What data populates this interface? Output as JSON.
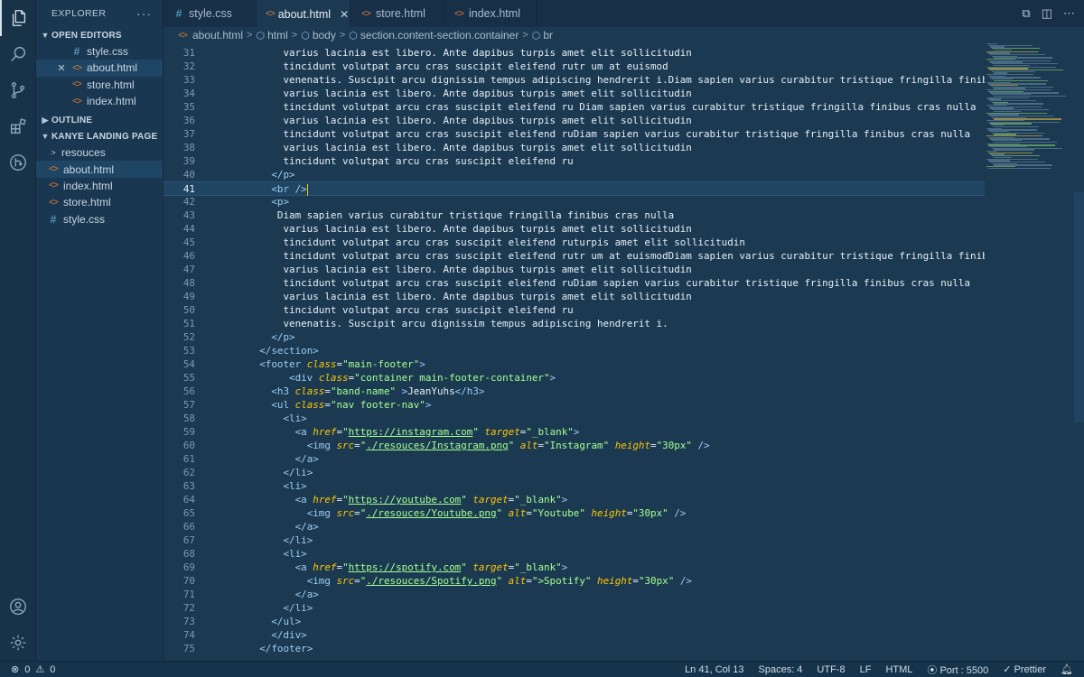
{
  "sidebar": {
    "title": "EXPLORER",
    "more": "···",
    "open_editors_title": "OPEN EDITORS",
    "open_editors": [
      {
        "name": "style.css",
        "type": "css"
      },
      {
        "name": "about.html",
        "type": "html"
      },
      {
        "name": "store.html",
        "type": "html"
      },
      {
        "name": "index.html",
        "type": "html"
      }
    ],
    "outline_title": "OUTLINE",
    "project_title": "KANYE LANDING PAGE",
    "files": [
      {
        "name": "resouces",
        "type": "folder"
      },
      {
        "name": "about.html",
        "type": "html"
      },
      {
        "name": "index.html",
        "type": "html"
      },
      {
        "name": "store.html",
        "type": "html"
      },
      {
        "name": "style.css",
        "type": "css"
      }
    ]
  },
  "tabs": [
    {
      "label": "style.css",
      "type": "css"
    },
    {
      "label": "about.html",
      "type": "html",
      "active": true
    },
    {
      "label": "store.html",
      "type": "html"
    },
    {
      "label": "index.html",
      "type": "html"
    }
  ],
  "breadcrumb": [
    "about.html",
    "html",
    "body",
    "section.content-section.container",
    "br"
  ],
  "editor": {
    "current_line": 41,
    "lines": [
      {
        "n": "31",
        "html": "        varius lacinia est libero. Ante dapibus turpis amet elit sollicitudin"
      },
      {
        "n": "32",
        "html": "        tincidunt volutpat arcu cras suscipit eleifend rutr um at euismod"
      },
      {
        "n": "33",
        "html": "        venenatis. Suscipit arcu dignissim tempus adipiscing hendrerit i.Diam sapien varius curabitur tristique fringilla finibus cras nulla"
      },
      {
        "n": "34",
        "html": "        varius lacinia est libero. Ante dapibus turpis amet elit sollicitudin"
      },
      {
        "n": "35",
        "html": "        tincidunt volutpat arcu cras suscipit eleifend ru Diam sapien varius curabitur tristique fringilla finibus cras nulla"
      },
      {
        "n": "36",
        "html": "        varius lacinia est libero. Ante dapibus turpis amet elit sollicitudin"
      },
      {
        "n": "37",
        "html": "        tincidunt volutpat arcu cras suscipit eleifend ruDiam sapien varius curabitur tristique fringilla finibus cras nulla"
      },
      {
        "n": "38",
        "html": "        varius lacinia est libero. Ante dapibus turpis amet elit sollicitudin"
      },
      {
        "n": "39",
        "html": "        tincidunt volutpat arcu cras suscipit eleifend ru"
      },
      {
        "n": "40",
        "html": "      <span class='tk-tag'>&lt;/p&gt;</span>"
      },
      {
        "n": "41",
        "html": "      <span class='tk-tag'>&lt;br /&gt;</span><span class='cursor'></span>"
      },
      {
        "n": "42",
        "html": "      <span class='tk-tag'>&lt;p&gt;</span>"
      },
      {
        "n": "43",
        "html": "       Diam sapien varius curabitur tristique fringilla finibus cras nulla"
      },
      {
        "n": "44",
        "html": "        varius lacinia est libero. Ante dapibus turpis amet elit sollicitudin"
      },
      {
        "n": "45",
        "html": "        tincidunt volutpat arcu cras suscipit eleifend ruturpis amet elit sollicitudin"
      },
      {
        "n": "46",
        "html": "        tincidunt volutpat arcu cras suscipit eleifend rutr um at euismodDiam sapien varius curabitur tristique fringilla finibus cras nulla"
      },
      {
        "n": "47",
        "html": "        varius lacinia est libero. Ante dapibus turpis amet elit sollicitudin"
      },
      {
        "n": "48",
        "html": "        tincidunt volutpat arcu cras suscipit eleifend ruDiam sapien varius curabitur tristique fringilla finibus cras nulla"
      },
      {
        "n": "49",
        "html": "        varius lacinia est libero. Ante dapibus turpis amet elit sollicitudin"
      },
      {
        "n": "50",
        "html": "        tincidunt volutpat arcu cras suscipit eleifend ru"
      },
      {
        "n": "51",
        "html": "        venenatis. Suscipit arcu dignissim tempus adipiscing hendrerit i."
      },
      {
        "n": "52",
        "html": "      <span class='tk-tag'>&lt;/p&gt;</span>"
      },
      {
        "n": "53",
        "html": "    <span class='tk-tag'>&lt;/section&gt;</span>"
      },
      {
        "n": "54",
        "html": "    <span class='tk-tag'>&lt;footer</span> <span class='tk-attr'>class</span><span class='tk-eq'>=</span><span class='tk-str'>\"main-footer\"</span><span class='tk-tag'>&gt;</span>"
      },
      {
        "n": "55",
        "html": "         <span class='tk-tag'>&lt;div</span> <span class='tk-attr'>class</span><span class='tk-eq'>=</span><span class='tk-str'>\"container main-footer-container\"</span><span class='tk-tag'>&gt;</span>"
      },
      {
        "n": "56",
        "html": "      <span class='tk-tag'>&lt;h3</span> <span class='tk-attr'>class</span><span class='tk-eq'>=</span><span class='tk-str'>\"band-name\"</span> <span class='tk-tag'>&gt;</span>JeanYuhs<span class='tk-tag'>&lt;/h3&gt;</span>"
      },
      {
        "n": "57",
        "html": "      <span class='tk-tag'>&lt;ul</span> <span class='tk-attr'>class</span><span class='tk-eq'>=</span><span class='tk-str'>\"nav footer-nav\"</span><span class='tk-tag'>&gt;</span>"
      },
      {
        "n": "58",
        "html": "        <span class='tk-tag'>&lt;li&gt;</span>"
      },
      {
        "n": "59",
        "html": "          <span class='tk-tag'>&lt;a</span> <span class='tk-attr'>href</span><span class='tk-eq'>=</span><span class='tk-str'>\"</span><span class='tk-link'>https://instagram.com</span><span class='tk-str'>\"</span> <span class='tk-attr'>target</span><span class='tk-eq'>=</span><span class='tk-str'>\"_blank\"</span><span class='tk-tag'>&gt;</span>"
      },
      {
        "n": "60",
        "html": "            <span class='tk-tag'>&lt;img</span> <span class='tk-attr'>src</span><span class='tk-eq'>=</span><span class='tk-str'>\"</span><span class='tk-link'>./resouces/Instagram.png</span><span class='tk-str'>\"</span> <span class='tk-attr'>alt</span><span class='tk-eq'>=</span><span class='tk-str'>\"Instagram\"</span> <span class='tk-attr'>height</span><span class='tk-eq'>=</span><span class='tk-str'>\"30px\"</span> <span class='tk-tag'>/&gt;</span>"
      },
      {
        "n": "61",
        "html": "          <span class='tk-tag'>&lt;/a&gt;</span>"
      },
      {
        "n": "62",
        "html": "        <span class='tk-tag'>&lt;/li&gt;</span>"
      },
      {
        "n": "63",
        "html": "        <span class='tk-tag'>&lt;li&gt;</span>"
      },
      {
        "n": "64",
        "html": "          <span class='tk-tag'>&lt;a</span> <span class='tk-attr'>href</span><span class='tk-eq'>=</span><span class='tk-str'>\"</span><span class='tk-link'>https://youtube.com</span><span class='tk-str'>\"</span> <span class='tk-attr'>target</span><span class='tk-eq'>=</span><span class='tk-str'>\"_blank\"</span><span class='tk-tag'>&gt;</span>"
      },
      {
        "n": "65",
        "html": "            <span class='tk-tag'>&lt;img</span> <span class='tk-attr'>src</span><span class='tk-eq'>=</span><span class='tk-str'>\"</span><span class='tk-link'>./resouces/Youtube.png</span><span class='tk-str'>\"</span> <span class='tk-attr'>alt</span><span class='tk-eq'>=</span><span class='tk-str'>\"Youtube\"</span> <span class='tk-attr'>height</span><span class='tk-eq'>=</span><span class='tk-str'>\"30px\"</span> <span class='tk-tag'>/&gt;</span>"
      },
      {
        "n": "66",
        "html": "          <span class='tk-tag'>&lt;/a&gt;</span>"
      },
      {
        "n": "67",
        "html": "        <span class='tk-tag'>&lt;/li&gt;</span>"
      },
      {
        "n": "68",
        "html": "        <span class='tk-tag'>&lt;li&gt;</span>"
      },
      {
        "n": "69",
        "html": "          <span class='tk-tag'>&lt;a</span> <span class='tk-attr'>href</span><span class='tk-eq'>=</span><span class='tk-str'>\"</span><span class='tk-link'>https://spotify.com</span><span class='tk-str'>\"</span> <span class='tk-attr'>target</span><span class='tk-eq'>=</span><span class='tk-str'>\"_blank\"</span><span class='tk-tag'>&gt;</span>"
      },
      {
        "n": "70",
        "html": "            <span class='tk-tag'>&lt;img</span> <span class='tk-attr'>src</span><span class='tk-eq'>=</span><span class='tk-str'>\"</span><span class='tk-link'>./resouces/Spotify.png</span><span class='tk-str'>\"</span> <span class='tk-attr'>alt</span><span class='tk-eq'>=</span><span class='tk-str'>\"&gt;Spotify\"</span> <span class='tk-attr'>height</span><span class='tk-eq'>=</span><span class='tk-str'>\"30px\"</span> <span class='tk-tag'>/&gt;</span>"
      },
      {
        "n": "71",
        "html": "          <span class='tk-tag'>&lt;/a&gt;</span>"
      },
      {
        "n": "72",
        "html": "        <span class='tk-tag'>&lt;/li&gt;</span>"
      },
      {
        "n": "73",
        "html": "      <span class='tk-tag'>&lt;/ul&gt;</span>"
      },
      {
        "n": "74",
        "html": "      <span class='tk-tag'>&lt;/div&gt;</span>"
      },
      {
        "n": "75",
        "html": "    <span class='tk-tag'>&lt;/footer&gt;</span>"
      }
    ]
  },
  "statusbar": {
    "errors": "0",
    "warnings": "0",
    "position": "Ln 41, Col 13",
    "spaces": "Spaces: 4",
    "encoding": "UTF-8",
    "eol": "LF",
    "language": "HTML",
    "port": "Port : 5500",
    "formatter": "Prettier"
  },
  "colors": {
    "background": "#1b3a52",
    "tag": "#9ecbf0",
    "attribute": "#ffc600",
    "string": "#a5ff90",
    "css_icon": "#519aba",
    "html_icon": "#e37933"
  },
  "icons": {
    "activity": [
      "files-icon",
      "search-icon",
      "source-control-icon",
      "extensions-icon",
      "remote-explorer-icon",
      "account-icon",
      "settings-gear-icon"
    ]
  }
}
